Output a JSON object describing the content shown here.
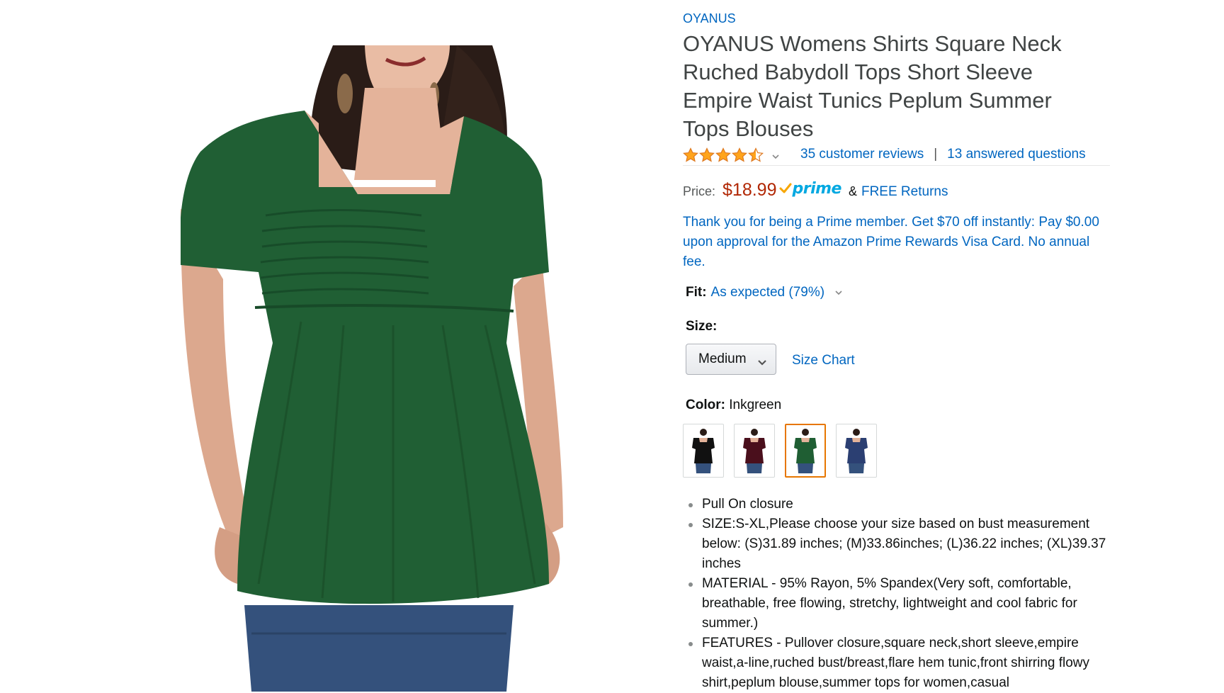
{
  "product": {
    "brand": "OYANUS",
    "title": "OYANUS Womens Shirts Square Neck Ruched Babydoll Tops Short Sleeve Empire Waist Tunics Peplum Summer Tops Blouses",
    "rating": 4.5,
    "rating_max": 5,
    "reviews_link": "35 customer reviews",
    "separator": "|",
    "questions_link": "13 answered questions",
    "price_label": "Price:",
    "price": "$18.99",
    "prime_badge": "prime",
    "ampersand": "&",
    "free_returns": "FREE Returns",
    "prime_offer": "Thank you for being a Prime member. Get $70 off instantly: Pay $0.00 upon approval for the Amazon Prime Rewards Visa Card. No annual fee.",
    "fit_label": "Fit:",
    "fit_value": "As expected (79%)",
    "size_label": "Size:",
    "size_selected": "Medium",
    "size_chart": "Size Chart",
    "color_label": "Color:",
    "color_value": "Inkgreen",
    "swatches": [
      {
        "name": "black",
        "color": "#111111",
        "selected": false
      },
      {
        "name": "wine",
        "color": "#4a0f1c",
        "selected": false
      },
      {
        "name": "inkgreen",
        "color": "#1f5e33",
        "selected": true
      },
      {
        "name": "navy",
        "color": "#2b3f72",
        "selected": false
      }
    ],
    "bullets": [
      "Pull On closure",
      "SIZE:S-XL,Please choose your size based on bust measurement below: (S)31.89 inches; (M)33.86inches; (L)36.22 inches; (XL)39.37 inches",
      "MATERIAL - 95% Rayon, 5% Spandex(Very soft, comfortable, breathable, free flowing, stretchy, lightweight and cool fabric for summer.)",
      "FEATURES - Pullover closure,square neck,short sleeve,empire waist,a-line,ruched bust/breast,flare hem tunic,front shirring flowy shirt,peplum blouse,summer tops for women,casual"
    ]
  },
  "colors": {
    "link": "#0066c0",
    "price": "#b12704",
    "prime": "#00a8e1",
    "star": "#ffa41c",
    "selected_border": "#e77600",
    "shirt": "#205f34"
  },
  "icons": {
    "rating_dropdown": "chevron-down-icon",
    "fit_dropdown": "chevron-down-icon",
    "size_dropdown": "chevron-down-icon",
    "prime_check": "check-icon"
  }
}
